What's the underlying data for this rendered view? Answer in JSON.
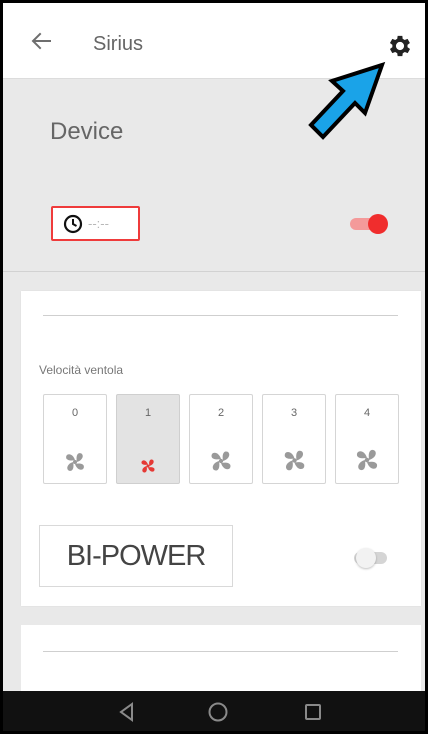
{
  "app_bar": {
    "back_icon": "arrow-left-icon",
    "title": "Sirius",
    "settings_icon": "gear-icon"
  },
  "annotation": {
    "icon": "blue-pointer-arrow",
    "color": "#1aa3e8"
  },
  "device": {
    "title": "Device",
    "timer": {
      "icon": "clock-icon",
      "value": "--:--"
    },
    "power_toggle_on": true
  },
  "fan_speed": {
    "label": "Velocità ventola",
    "options": [
      {
        "label": "0",
        "selected": false
      },
      {
        "label": "1",
        "selected": true
      },
      {
        "label": "2",
        "selected": false
      },
      {
        "label": "3",
        "selected": false
      },
      {
        "label": "4",
        "selected": false
      }
    ],
    "selected_color": "#e53935",
    "icon": "fan-icon"
  },
  "bi_power": {
    "label": "BI-POWER",
    "enabled": false
  },
  "system_nav": {
    "back_icon": "triangle-back-icon",
    "home_icon": "circle-home-icon",
    "recents_icon": "square-recents-icon"
  }
}
